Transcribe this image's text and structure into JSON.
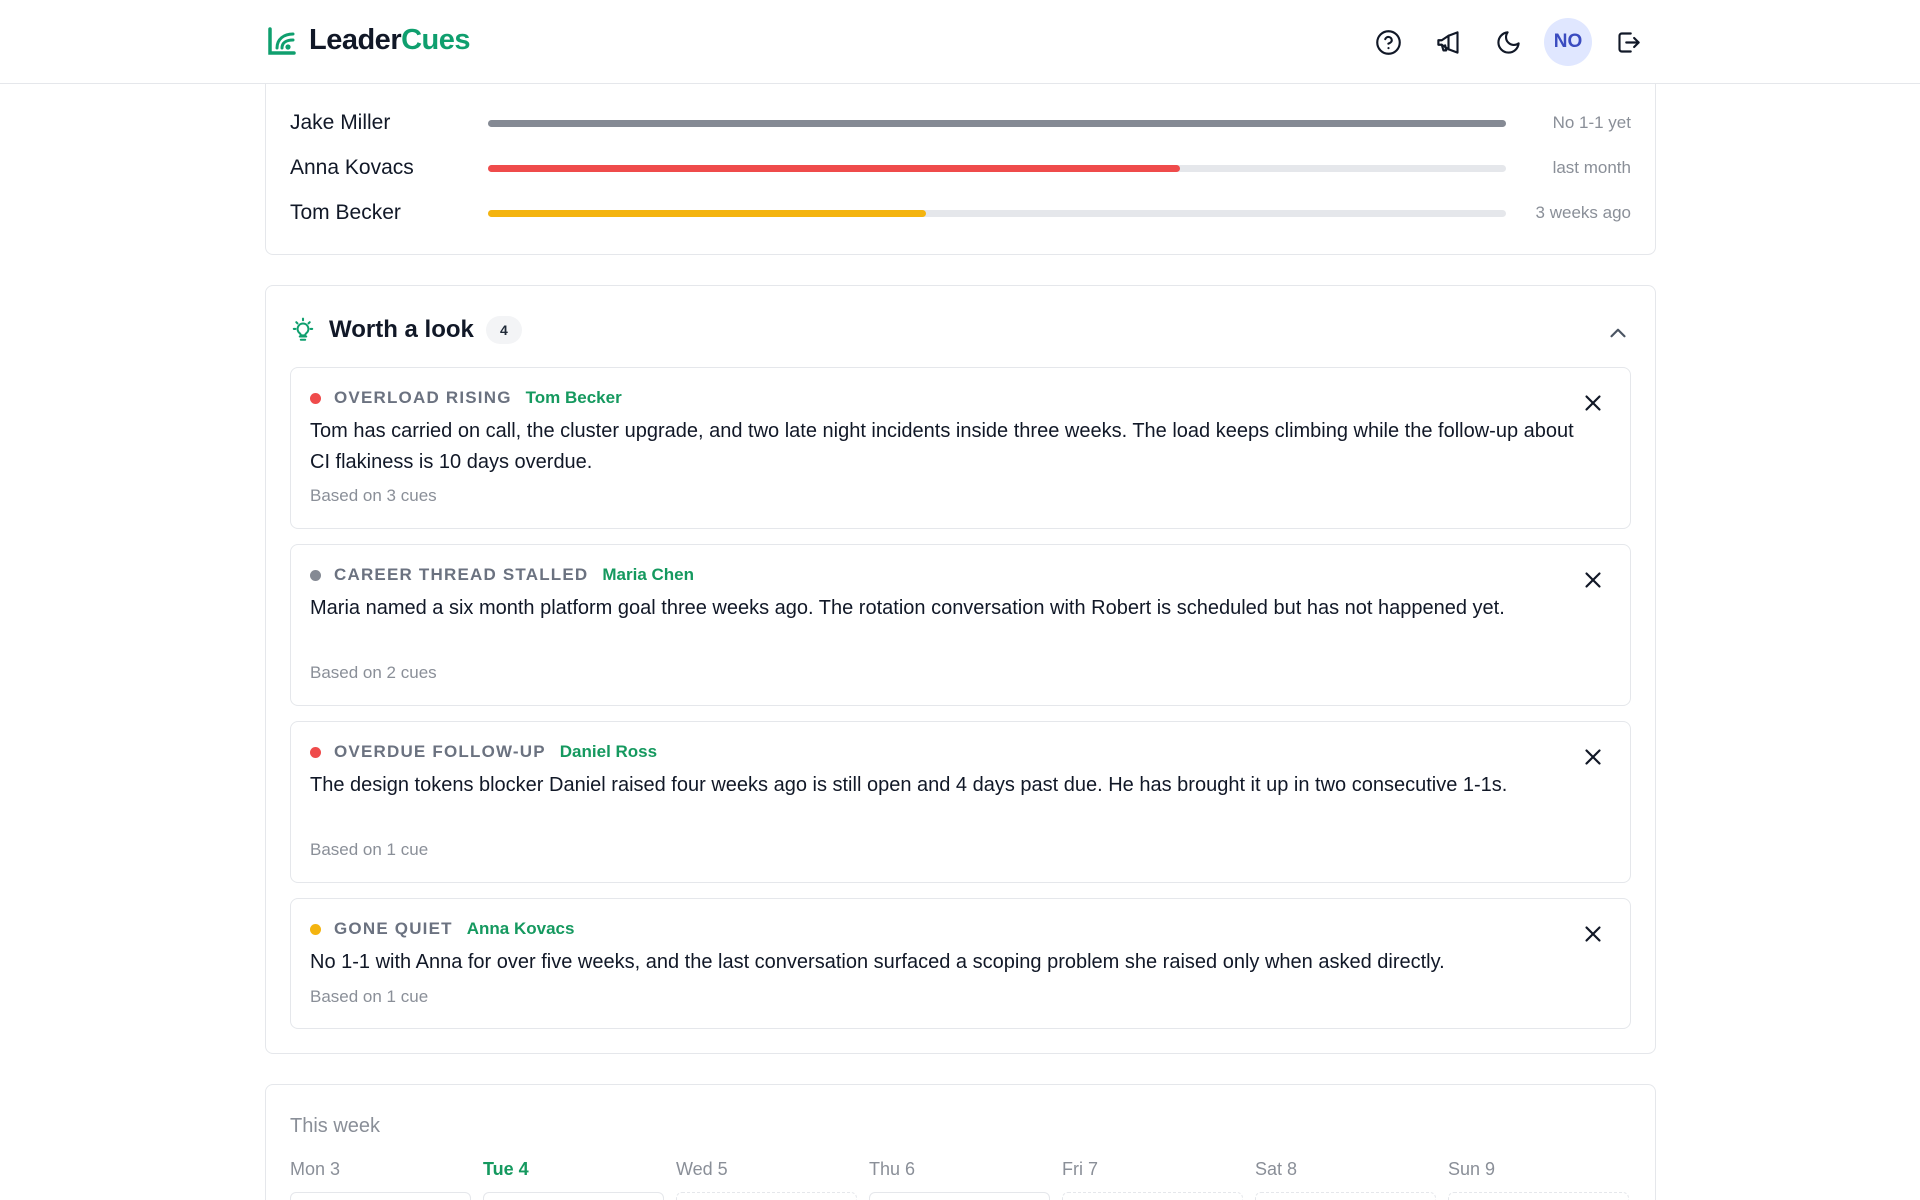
{
  "header": {
    "logo_main": "Leader",
    "logo_accent": "Cues",
    "avatar_initials": "NO",
    "brand_color": "#0f9f6e",
    "icons": [
      "help-icon",
      "megaphone-icon",
      "moon-icon",
      "logout-icon"
    ]
  },
  "oneones": [
    {
      "name": "Jake Miller",
      "status": "No 1-1 yet",
      "fill": 1.0,
      "color": "#858a94"
    },
    {
      "name": "Anna Kovacs",
      "status": "last month",
      "fill": 0.68,
      "color": "#ef4b4b"
    },
    {
      "name": "Tom Becker",
      "status": "3 weeks ago",
      "fill": 0.43,
      "color": "#f4b40f"
    }
  ],
  "worth": {
    "title": "Worth a look",
    "count": "4",
    "items": [
      {
        "tag": "OVERLOAD RISING",
        "person": "Tom Becker",
        "dot_color": "#ef4b4b",
        "body": "Tom has carried on call, the cluster upgrade, and two late night incidents inside three weeks. The load keeps climbing while the follow-up about CI flakiness is 10 days overdue.",
        "foot": "Based on 3 cues"
      },
      {
        "tag": "CAREER THREAD STALLED",
        "person": "Maria Chen",
        "dot_color": "#858a94",
        "body": "Maria named a six month platform goal three weeks ago. The rotation conversation with Robert is scheduled but has not happened yet.",
        "foot": "Based on 2 cues"
      },
      {
        "tag": "OVERDUE FOLLOW-UP",
        "person": "Daniel Ross",
        "dot_color": "#ef4b4b",
        "body": "The design tokens blocker Daniel raised four weeks ago is still open and 4 days past due. He has brought it up in two consecutive 1-1s.",
        "foot": "Based on 1 cue"
      },
      {
        "tag": "GONE QUIET",
        "person": "Anna Kovacs",
        "dot_color": "#f4b40f",
        "body": "No 1-1 with Anna for over five weeks, and the last conversation surfaced a scoping problem she raised only when asked directly.",
        "foot": "Based on 1 cue"
      }
    ]
  },
  "week": {
    "title": "This week",
    "days": [
      "Mon 3",
      "Tue 4",
      "Wed 5",
      "Thu 6",
      "Fri 7",
      "Sat 8",
      "Sun 9"
    ],
    "today": "Tue 4"
  }
}
